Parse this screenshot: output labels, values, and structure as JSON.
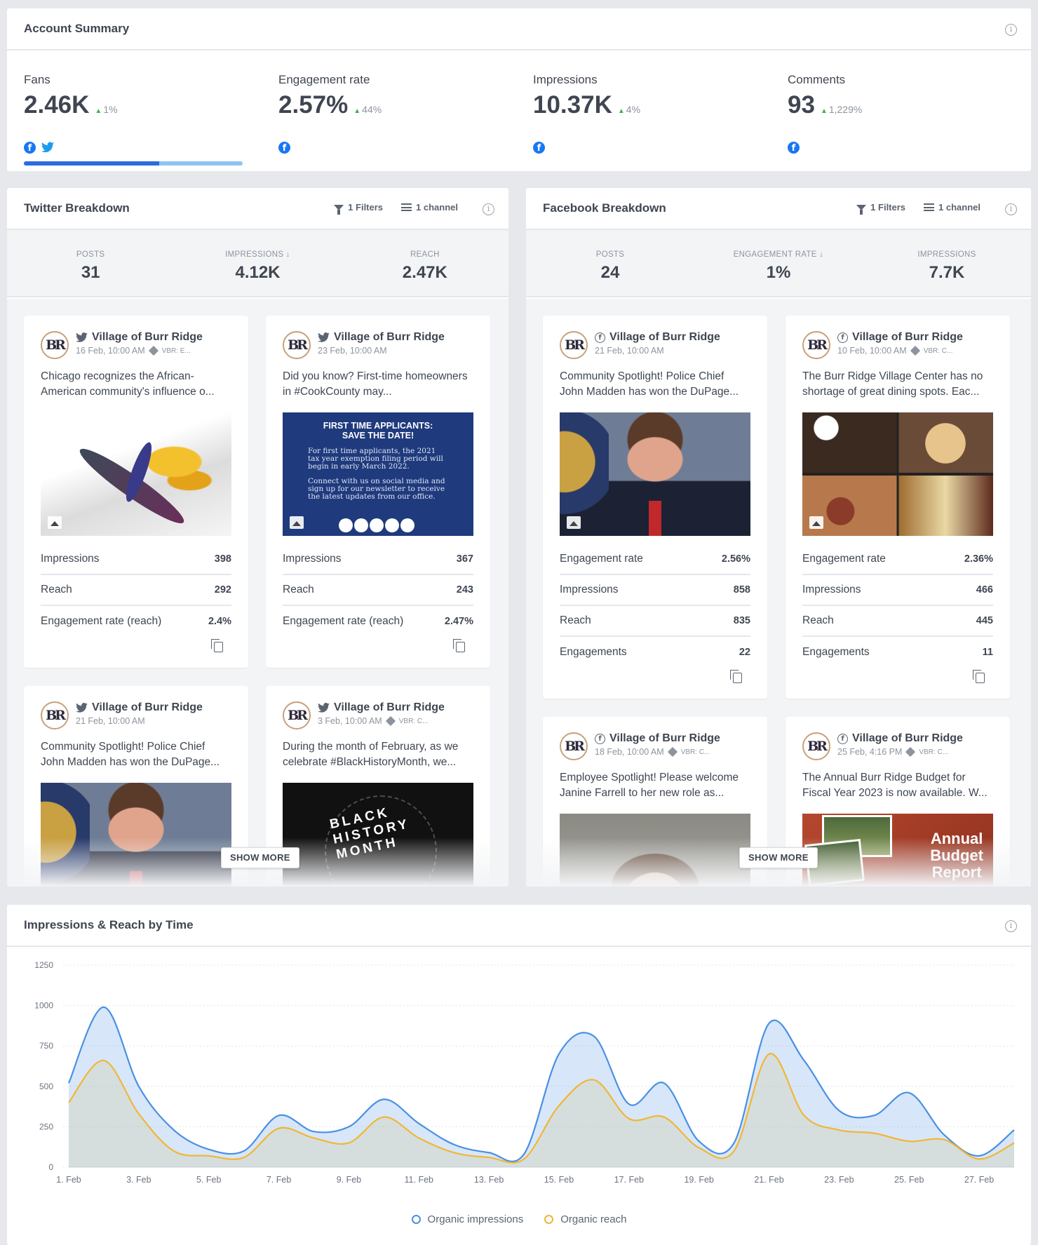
{
  "account_summary": {
    "title": "Account Summary",
    "metrics": [
      {
        "label": "Fans",
        "value": "2.46K",
        "delta": "1%",
        "networks": [
          "facebook",
          "twitter"
        ]
      },
      {
        "label": "Engagement rate",
        "value": "2.57%",
        "delta": "44%",
        "networks": [
          "facebook"
        ]
      },
      {
        "label": "Impressions",
        "value": "10.37K",
        "delta": "4%",
        "networks": [
          "facebook"
        ]
      },
      {
        "label": "Comments",
        "value": "93",
        "delta": "1,229%",
        "networks": [
          "facebook"
        ]
      }
    ],
    "fans_split": 0.62
  },
  "twitter": {
    "title": "Twitter Breakdown",
    "filters": "1 Filters",
    "channel": "1 channel",
    "stats": [
      {
        "label": "POSTS",
        "value": "31"
      },
      {
        "label": "IMPRESSIONS ↓",
        "value": "4.12K"
      },
      {
        "label": "REACH",
        "value": "2.47K"
      }
    ],
    "posts": [
      {
        "author": "Village of Burr Ridge",
        "date": "16 Feb, 10:00 AM",
        "tag": "VBR: E...",
        "text": "Chicago recognizes the African-American community's influence o...",
        "rows": [
          {
            "label": "Impressions",
            "value": "398"
          },
          {
            "label": "Reach",
            "value": "292"
          },
          {
            "label": "Engagement rate (reach)",
            "value": "2.4%"
          }
        ]
      },
      {
        "author": "Village of Burr Ridge",
        "date": "23 Feb, 10:00 AM",
        "tag": "",
        "text": "Did you know? First-time homeowners in #CookCounty may...",
        "image_heading": "FIRST TIME APPLICANTS:\nSAVE THE DATE!",
        "image_text": "For first time applicants, the 2021 tax year exemption filing period will begin in early March 2022.",
        "image_text2": "Connect with us on social media and sign up for our newsletter to receive the latest updates from our office.",
        "rows": [
          {
            "label": "Impressions",
            "value": "367"
          },
          {
            "label": "Reach",
            "value": "243"
          },
          {
            "label": "Engagement rate (reach)",
            "value": "2.47%"
          }
        ]
      },
      {
        "author": "Village of Burr Ridge",
        "date": "21 Feb, 10:00 AM",
        "tag": "",
        "text": "Community Spotlight! Police Chief John Madden has won the DuPage..."
      },
      {
        "author": "Village of Burr Ridge",
        "date": "3 Feb, 10:00 AM",
        "tag": "VBR: C...",
        "text": "During the month of February, as we celebrate #BlackHistoryMonth, we...",
        "image_text": "BLACK HISTORY MONTH"
      }
    ],
    "show_more": "SHOW MORE"
  },
  "facebook": {
    "title": "Facebook Breakdown",
    "filters": "1 Filters",
    "channel": "1 channel",
    "stats": [
      {
        "label": "POSTS",
        "value": "24"
      },
      {
        "label": "ENGAGEMENT RATE ↓",
        "value": "1%"
      },
      {
        "label": "IMPRESSIONS",
        "value": "7.7K"
      }
    ],
    "posts": [
      {
        "author": "Village of Burr Ridge",
        "date": "21 Feb, 10:00 AM",
        "tag": "",
        "text": "Community Spotlight! Police Chief John Madden has won the DuPage...",
        "rows": [
          {
            "label": "Engagement rate",
            "value": "2.56%"
          },
          {
            "label": "Impressions",
            "value": "858"
          },
          {
            "label": "Reach",
            "value": "835"
          },
          {
            "label": "Engagements",
            "value": "22"
          }
        ]
      },
      {
        "author": "Village of Burr Ridge",
        "date": "10 Feb, 10:00 AM",
        "tag": "VBR: C...",
        "text": "The Burr Ridge Village Center has no shortage of great dining spots. Eac...",
        "rows": [
          {
            "label": "Engagement rate",
            "value": "2.36%"
          },
          {
            "label": "Impressions",
            "value": "466"
          },
          {
            "label": "Reach",
            "value": "445"
          },
          {
            "label": "Engagements",
            "value": "11"
          }
        ]
      },
      {
        "author": "Village of Burr Ridge",
        "date": "18 Feb, 10:00 AM",
        "tag": "VBR: C...",
        "text": "Employee Spotlight! Please welcome Janine Farrell to her new role as..."
      },
      {
        "author": "Village of Burr Ridge",
        "date": "25 Feb, 4:16 PM",
        "tag": "VBR: C...",
        "text": "The Annual Burr Ridge Budget for Fiscal Year 2023 is now available. W...",
        "image_text": "Annual\nBudget\nReport"
      }
    ],
    "show_more": "SHOW MORE"
  },
  "chart_panel": {
    "title": "Impressions & Reach by Time"
  },
  "chart_data": {
    "type": "area",
    "title": "Impressions & Reach by Time",
    "x": [
      "1. Feb",
      "2. Feb",
      "3. Feb",
      "4. Feb",
      "5. Feb",
      "6. Feb",
      "7. Feb",
      "8. Feb",
      "9. Feb",
      "10. Feb",
      "11. Feb",
      "12. Feb",
      "13. Feb",
      "14. Feb",
      "15. Feb",
      "16. Feb",
      "17. Feb",
      "18. Feb",
      "19. Feb",
      "20. Feb",
      "21. Feb",
      "22. Feb",
      "23. Feb",
      "24. Feb",
      "25. Feb",
      "26. Feb",
      "27. Feb",
      "28. Feb"
    ],
    "x_tick_labels": [
      "1. Feb",
      "3. Feb",
      "5. Feb",
      "7. Feb",
      "9. Feb",
      "11. Feb",
      "13. Feb",
      "15. Feb",
      "17. Feb",
      "19. Feb",
      "21. Feb",
      "23. Feb",
      "25. Feb",
      "27. Feb"
    ],
    "series": [
      {
        "name": "Organic impressions",
        "color": "#4a90e2",
        "values": [
          520,
          990,
          500,
          230,
          110,
          100,
          320,
          220,
          250,
          420,
          270,
          140,
          90,
          80,
          700,
          810,
          390,
          520,
          160,
          150,
          890,
          660,
          350,
          320,
          460,
          200,
          70,
          230
        ]
      },
      {
        "name": "Organic reach",
        "color": "#f2b632",
        "values": [
          400,
          660,
          330,
          100,
          70,
          60,
          240,
          180,
          150,
          310,
          180,
          90,
          60,
          50,
          380,
          540,
          300,
          310,
          120,
          100,
          700,
          320,
          230,
          210,
          160,
          170,
          50,
          150
        ]
      }
    ],
    "ylim": [
      0,
      1250
    ],
    "y_ticks": [
      "0",
      "250",
      "500",
      "750",
      "1000",
      "1250"
    ],
    "grid": true,
    "legend": "bottom-center"
  }
}
